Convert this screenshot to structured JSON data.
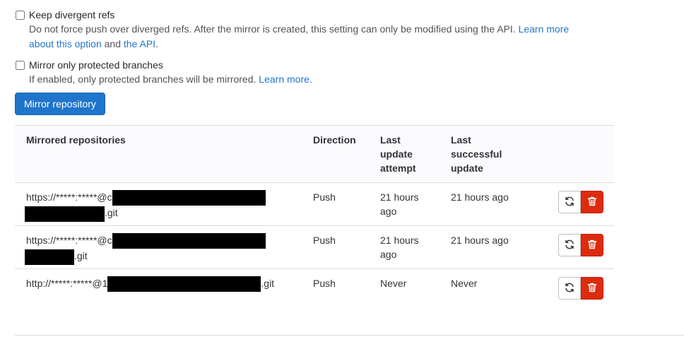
{
  "options": {
    "keep_divergent": {
      "label": "Keep divergent refs",
      "help_prefix": "Do not force push over diverged refs. After the mirror is created, this setting can only be modified using the API.",
      "learn_more_1": "Learn more",
      "learn_more_2": "about this option",
      "and": " and ",
      "api_link": "the API",
      "period": "."
    },
    "protected_only": {
      "label": "Mirror only protected branches",
      "help_prefix": "If enabled, only protected branches will be mirrored.",
      "learn_more": "Learn more."
    }
  },
  "mirror_button": "Mirror repository",
  "table": {
    "headers": {
      "repos": "Mirrored repositories",
      "direction": "Direction",
      "last_attempt": "Last update attempt",
      "last_success": "Last successful update"
    },
    "rows": [
      {
        "url_prefix": "https://*****:*****@c",
        "url_suffix": ".git",
        "direction": "Push",
        "last_attempt": "21 hours ago",
        "last_success": "21 hours ago"
      },
      {
        "url_prefix": "https://*****:*****@c",
        "url_suffix": ".git",
        "direction": "Push",
        "last_attempt": "21 hours ago",
        "last_success": "21 hours ago"
      },
      {
        "url_prefix": "http://*****:*****@1",
        "url_suffix": ".git",
        "direction": "Push",
        "last_attempt": "Never",
        "last_success": "Never"
      }
    ]
  },
  "icons": {
    "sync": "sync-icon",
    "delete": "trash-icon"
  },
  "colors": {
    "primary": "#1f75cb",
    "danger": "#dd2b0e"
  }
}
